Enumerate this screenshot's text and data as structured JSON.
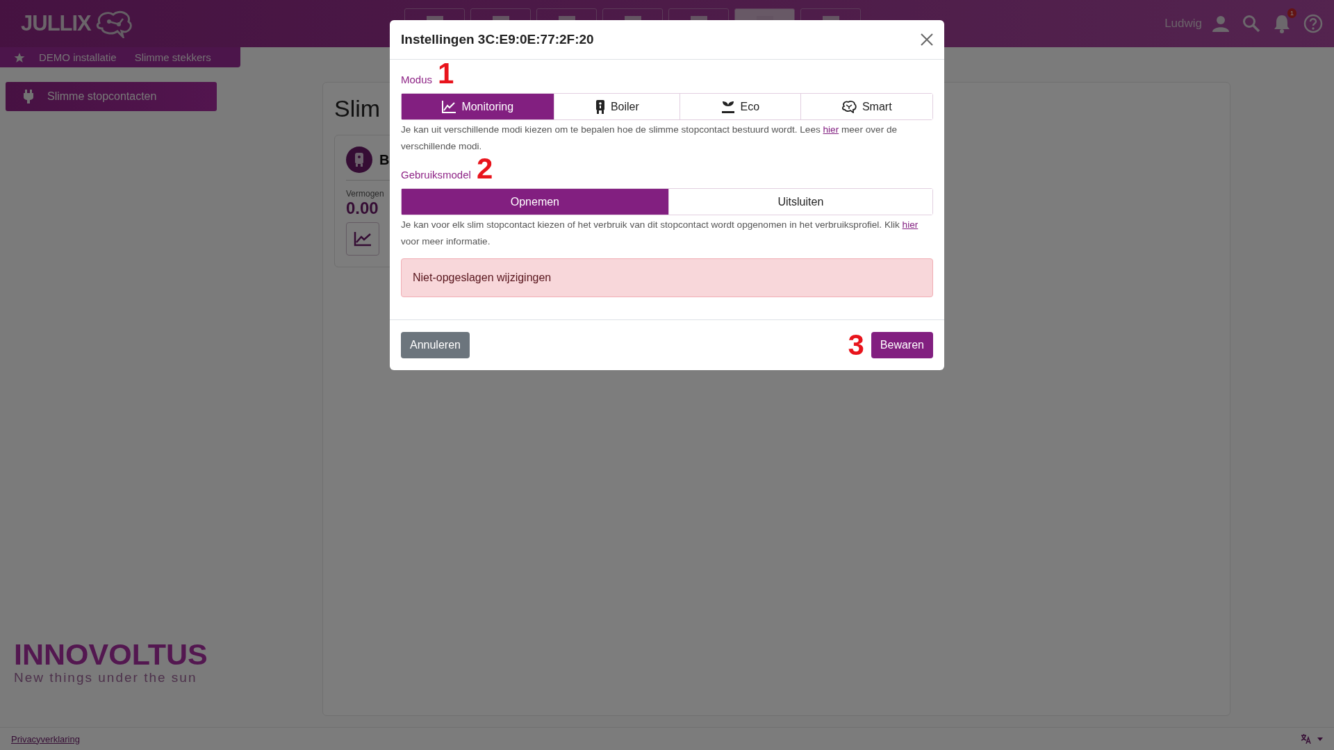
{
  "header": {
    "logo": "JULLIX",
    "nav_tabs": [
      {
        "selected": false
      },
      {
        "selected": false
      },
      {
        "selected": false
      },
      {
        "selected": false
      },
      {
        "selected": false
      },
      {
        "selected": true
      },
      {
        "selected": false
      }
    ],
    "user": "Ludwig",
    "notification_count": "1"
  },
  "breadcrumb": [
    "DEMO installatie",
    "Slimme stekkers"
  ],
  "sidebar": {
    "items": [
      {
        "label": "Slimme stopcontacten",
        "selected": true
      }
    ]
  },
  "main": {
    "title": "Slim",
    "device": {
      "name": "B",
      "power_label": "Vermogen",
      "power_value": "0.00"
    }
  },
  "brand": {
    "name": "INNOVOLTUS",
    "tagline": "New things under the sun"
  },
  "footer": {
    "privacy_link": "Privacyverklaring"
  },
  "modal": {
    "title": "Instellingen 3C:E9:0E:77:2F:20",
    "sections": [
      {
        "label": "Modus",
        "annotation": "1",
        "options": [
          {
            "label": "Monitoring",
            "kind": "chart",
            "selected": true
          },
          {
            "label": "Boiler",
            "kind": "boiler",
            "selected": false
          },
          {
            "label": "Eco",
            "kind": "plant",
            "selected": false
          },
          {
            "label": "Smart",
            "kind": "brain",
            "selected": false
          }
        ],
        "help_before": "Je kan uit verschillende modi kiezen om te bepalen hoe de slimme stopcontact bestuurd wordt. Lees",
        "help_link": "hier",
        "help_after": "meer over de verschillende modi."
      },
      {
        "label": "Gebruiksmodel",
        "annotation": "2",
        "options": [
          {
            "label": "Opnemen",
            "selected": true
          },
          {
            "label": "Uitsluiten",
            "selected": false
          }
        ],
        "help_before": "Je kan voor elk slim stopcontact kiezen of het verbruik van dit stopcontact wordt opgenomen in het verbruiksprofiel. Klik",
        "help_link": "hier",
        "help_after": "voor meer informatie."
      }
    ],
    "alert": "Niet-opgeslagen wijzigingen",
    "cancel": "Annuleren",
    "save_annotation": "3",
    "save": "Bewaren"
  }
}
